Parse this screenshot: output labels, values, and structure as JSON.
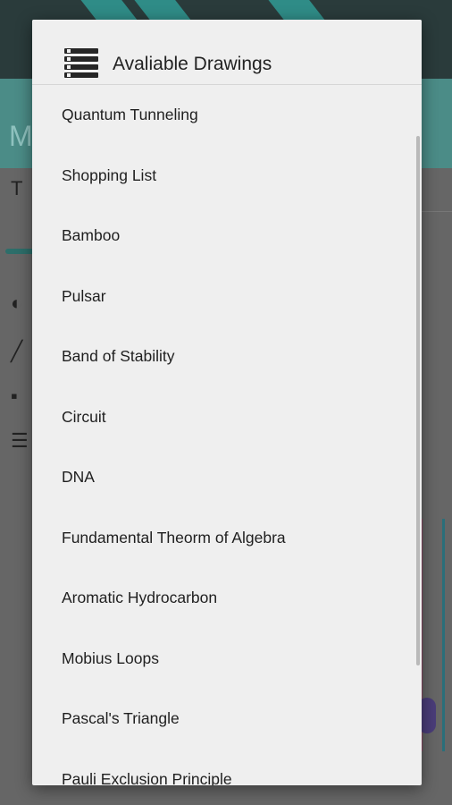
{
  "dialog": {
    "title": "Avaliable Drawings",
    "icon": "list-icon",
    "items": [
      "Quantum Tunneling",
      "Shopping List",
      "Bamboo",
      "Pulsar",
      "Band of Stability",
      "Circuit",
      "DNA",
      "Fundamental Theorm of Algebra",
      "Aromatic Hydrocarbon",
      "Mobius Loops",
      "Pascal's Triangle",
      "Pauli Exclusion Principle"
    ]
  },
  "background": {
    "header_letter": "M",
    "overlay_color": "#5b5b5b",
    "accent_color": "#2f8c87"
  }
}
